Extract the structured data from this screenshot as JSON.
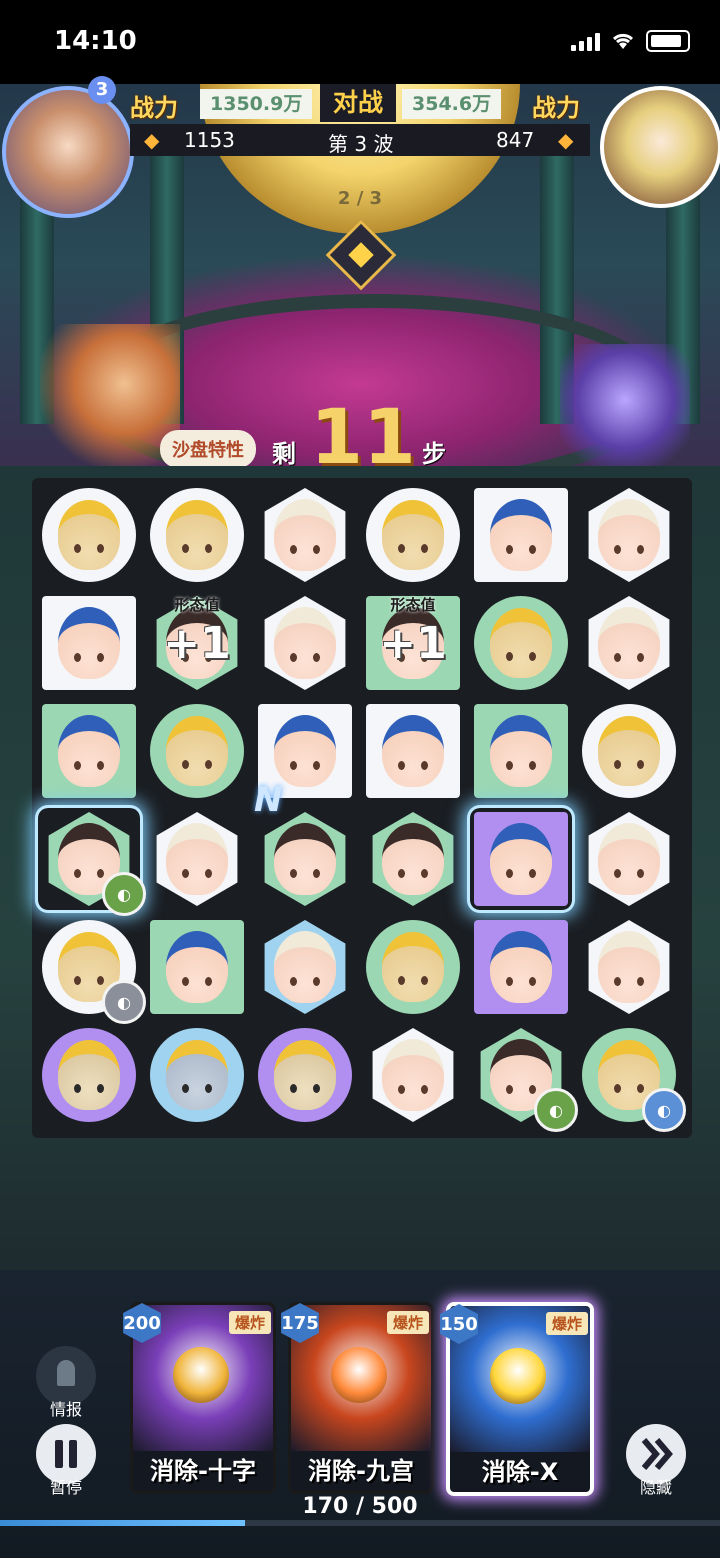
{
  "status_bar": {
    "time": "14:10"
  },
  "hud": {
    "power_label": "战力",
    "vs_label": "对战",
    "player_power": "1350.9万",
    "enemy_power": "354.6万",
    "player_score": "1153",
    "enemy_score": "847",
    "wave": "第 3 波",
    "wave_progress": "2 / 3",
    "player_level_badge": "3"
  },
  "moves": {
    "sandbox_label": "沙盘特性",
    "remaining_label": "剩",
    "remaining_value": "11",
    "steps_label": "步"
  },
  "board": {
    "bonus_label": "形态值",
    "bonus_value": "+1",
    "tiles": [
      [
        {
          "shape": "circle",
          "bg": "white",
          "face": "yellow"
        },
        {
          "shape": "circle",
          "bg": "white",
          "face": "yellow"
        },
        {
          "shape": "hexagon",
          "bg": "white",
          "face": "blue"
        },
        {
          "shape": "circle",
          "bg": "white",
          "face": "yellow"
        },
        {
          "shape": "square",
          "bg": "white",
          "face": "orange"
        },
        {
          "shape": "hexagon",
          "bg": "white",
          "face": "blue"
        }
      ],
      [
        {
          "shape": "square",
          "bg": "white",
          "face": "orange"
        },
        {
          "shape": "hexagon",
          "bg": "green",
          "face": "dark",
          "bonus": true
        },
        {
          "shape": "hexagon",
          "bg": "white",
          "face": "blue"
        },
        {
          "shape": "square",
          "bg": "green",
          "face": "dark",
          "bonus": true
        },
        {
          "shape": "circle",
          "bg": "green",
          "face": "yellow"
        },
        {
          "shape": "hexagon",
          "bg": "white",
          "face": "blue"
        }
      ],
      [
        {
          "shape": "square",
          "bg": "green",
          "face": "orange"
        },
        {
          "shape": "circle",
          "bg": "green",
          "face": "yellow"
        },
        {
          "shape": "square",
          "bg": "white",
          "face": "orange"
        },
        {
          "shape": "square",
          "bg": "white",
          "face": "orange"
        },
        {
          "shape": "square",
          "bg": "green",
          "face": "orange"
        },
        {
          "shape": "circle",
          "bg": "white",
          "face": "yellow"
        }
      ],
      [
        {
          "shape": "hexagon",
          "bg": "green",
          "face": "dark",
          "badge": "green",
          "glow": true
        },
        {
          "shape": "hexagon",
          "bg": "white",
          "face": "blue"
        },
        {
          "shape": "hexagon",
          "bg": "green",
          "face": "dark"
        },
        {
          "shape": "hexagon",
          "bg": "green",
          "face": "dark"
        },
        {
          "shape": "square",
          "bg": "purple",
          "face": "orange",
          "glow": true
        },
        {
          "shape": "hexagon",
          "bg": "white",
          "face": "blue"
        }
      ],
      [
        {
          "shape": "circle",
          "bg": "white",
          "face": "yellow",
          "badge": "gray"
        },
        {
          "shape": "square",
          "bg": "green",
          "face": "orange"
        },
        {
          "shape": "hexagon",
          "bg": "blue",
          "face": "blue"
        },
        {
          "shape": "circle",
          "bg": "green",
          "face": "yellow"
        },
        {
          "shape": "square",
          "bg": "purple",
          "face": "orange"
        },
        {
          "shape": "hexagon",
          "bg": "white",
          "face": "blue"
        }
      ],
      [
        {
          "shape": "circle",
          "bg": "purple",
          "face": "owl"
        },
        {
          "shape": "circle",
          "bg": "blue",
          "face": "shark"
        },
        {
          "shape": "circle",
          "bg": "purple",
          "face": "owl"
        },
        {
          "shape": "hexagon",
          "bg": "white",
          "face": "blue"
        },
        {
          "shape": "hexagon",
          "bg": "green",
          "face": "dark",
          "badge": "green"
        },
        {
          "shape": "circle",
          "bg": "green",
          "face": "yellow",
          "badge": "blue"
        }
      ]
    ],
    "special_mark": "N"
  },
  "skills": [
    {
      "cost": "200",
      "tag": "爆炸",
      "name": "消除-十字",
      "color": "#7a3fb8",
      "skull": "#f0b43a",
      "selected": false
    },
    {
      "cost": "175",
      "tag": "爆炸",
      "name": "消除-九宫",
      "color": "#c8461e",
      "skull": "#ff8a3a",
      "selected": false
    },
    {
      "cost": "150",
      "tag": "爆炸",
      "name": "消除-X",
      "color": "#2f6ed0",
      "skull": "#ffd63a",
      "selected": true
    }
  ],
  "side_buttons": {
    "intel_label": "情报",
    "pause_label": "暂停",
    "hide_label": "隐藏"
  },
  "energy": {
    "text": "170 / 500",
    "fraction": 0.34
  }
}
